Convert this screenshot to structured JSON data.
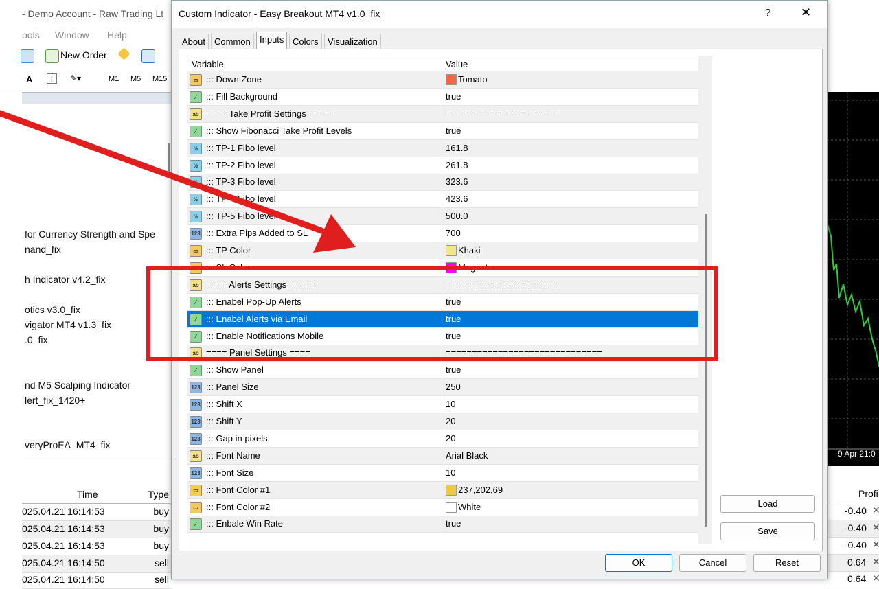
{
  "background": {
    "title": "- Demo Account - Raw Trading Lt",
    "menu": [
      "ools",
      "Window",
      "Help"
    ],
    "toolbar": {
      "new_order_label": "New Order"
    },
    "timeframes": [
      "M1",
      "M5",
      "M15"
    ],
    "navigator_items": [
      "for Currency Strength and Spe",
      "nand_fix",
      "h Indicator v4.2_fix",
      "otics v3.0_fix",
      "vigator MT4 v1.3_fix",
      ".0_fix",
      "nd M5 Scalping Indicator",
      "lert_fix_1420+",
      "veryProEA_MT4_fix"
    ],
    "terminal_headers": {
      "time": "Time",
      "type": "Type",
      "profit": "Profi"
    },
    "terminal_rows": [
      {
        "time": "025.04.21 16:14:53",
        "type": "buy",
        "profit": "-0.40"
      },
      {
        "time": "025.04.21 16:14:53",
        "type": "buy",
        "profit": "-0.40"
      },
      {
        "time": "025.04.21 16:14:53",
        "type": "buy",
        "profit": "-0.40"
      },
      {
        "time": "025.04.21 16:14:50",
        "type": "sell",
        "profit": "0.64"
      },
      {
        "time": "025.04.21 16:14:50",
        "type": "sell",
        "profit": "0.64"
      }
    ],
    "chart_date_label": "9 Apr 21:0"
  },
  "dialog": {
    "title": "Custom Indicator - Easy Breakout MT4 v1.0_fix",
    "help_glyph": "?",
    "close_glyph": "✕",
    "tabs": [
      "About",
      "Common",
      "Inputs",
      "Colors",
      "Visualization"
    ],
    "active_tab": "Inputs",
    "columns": {
      "variable": "Variable",
      "value": "Value"
    },
    "rows": [
      {
        "type": "col",
        "name": "::: Down Zone",
        "value": "Tomato",
        "swatch": "#ff6347"
      },
      {
        "type": "bool",
        "name": "::: Fill Background",
        "value": "true"
      },
      {
        "type": "ab",
        "name": "==== Take Profit Settings =====",
        "value": "======================"
      },
      {
        "type": "bool",
        "name": "::: Show Fibonacci Take Profit Levels",
        "value": "true"
      },
      {
        "type": "dbl",
        "name": "::: TP-1 Fibo level",
        "value": "161.8"
      },
      {
        "type": "dbl",
        "name": "::: TP-2 Fibo level",
        "value": "261.8"
      },
      {
        "type": "dbl",
        "name": "::: TP-3 Fibo level",
        "value": "323.6"
      },
      {
        "type": "dbl",
        "name": "::: TP-4 Fibo level",
        "value": "423.6"
      },
      {
        "type": "dbl",
        "name": "::: TP-5 Fibo level",
        "value": "500.0"
      },
      {
        "type": "int",
        "name": "::: Extra Pips Added to SL",
        "value": "700"
      },
      {
        "type": "col",
        "name": "::: TP Color",
        "value": "Khaki",
        "swatch": "#f0e68c"
      },
      {
        "type": "col",
        "name": "::: SL Color",
        "value": "Magenta",
        "swatch": "#ff00ff"
      },
      {
        "type": "ab",
        "name": "==== Alerts Settings =====",
        "value": "======================"
      },
      {
        "type": "bool",
        "name": "::: Enabel Pop-Up Alerts",
        "value": "true"
      },
      {
        "type": "bool",
        "name": "::: Enabel Alerts via Email",
        "value": "true",
        "selected": true
      },
      {
        "type": "bool",
        "name": "::: Enable Notifications Mobile",
        "value": "true"
      },
      {
        "type": "ab",
        "name": "==== Panel Settings ====",
        "value": "=============================="
      },
      {
        "type": "bool",
        "name": "::: Show Panel",
        "value": "true"
      },
      {
        "type": "int",
        "name": "::: Panel Size",
        "value": "250"
      },
      {
        "type": "int",
        "name": "::: Shift X",
        "value": "10"
      },
      {
        "type": "int",
        "name": "::: Shift Y",
        "value": "20"
      },
      {
        "type": "int",
        "name": "::: Gap in pixels",
        "value": "20"
      },
      {
        "type": "ab",
        "name": "::: Font Name",
        "value": "Arial Black"
      },
      {
        "type": "int",
        "name": "::: Font Size",
        "value": "10"
      },
      {
        "type": "col",
        "name": "::: Font Color #1",
        "value": "237,202,69",
        "swatch": "#edca45"
      },
      {
        "type": "col",
        "name": "::: Font Color #2",
        "value": "White",
        "swatch": "#ffffff"
      },
      {
        "type": "bool",
        "name": "::: Enbale Win Rate",
        "value": "true"
      }
    ],
    "side_buttons": {
      "load": "Load",
      "save": "Save"
    },
    "footer_buttons": {
      "ok": "OK",
      "cancel": "Cancel",
      "reset": "Reset"
    }
  },
  "annotation": {
    "arrow_color": "#e01e1e",
    "box_color": "#e01e1e"
  }
}
